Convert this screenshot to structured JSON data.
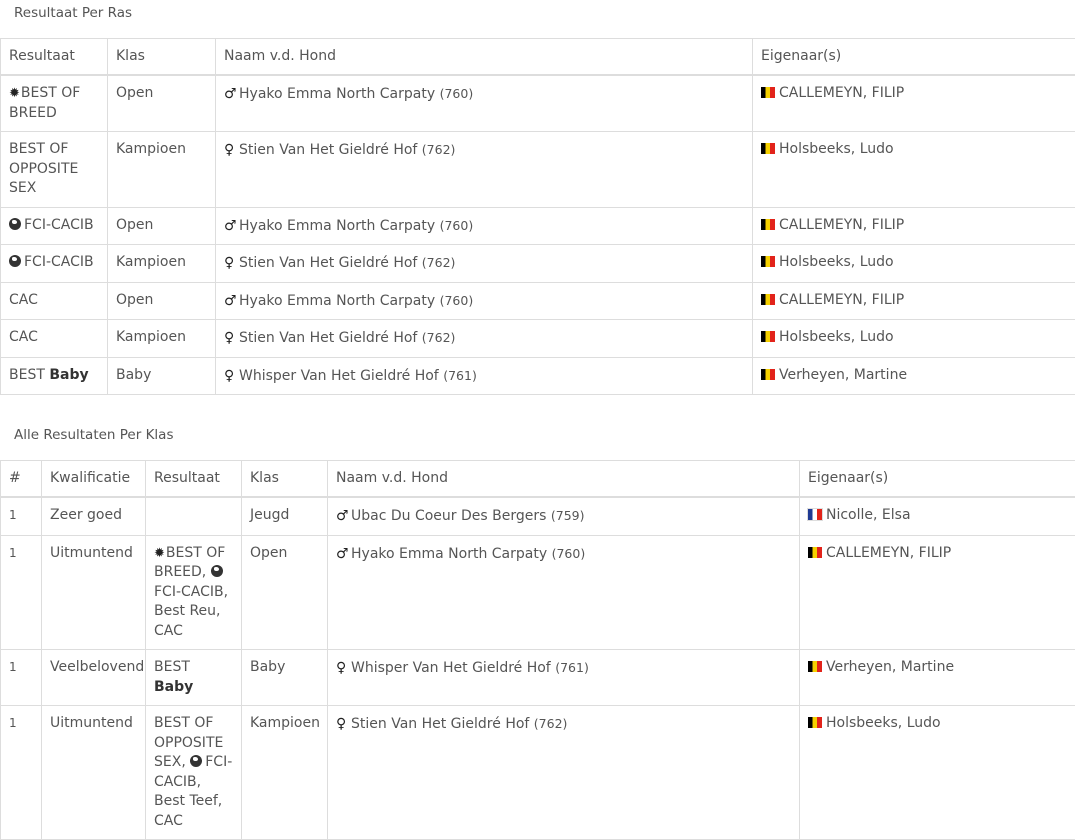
{
  "section1": {
    "title": "Resultaat Per Ras",
    "headers": [
      "Resultaat",
      "Klas",
      "Naam v.d. Hond",
      "Eigenaar(s)"
    ],
    "rows": [
      {
        "icon": "star",
        "result": "BEST OF BREED",
        "klas": "Open",
        "sex": "♂",
        "dog": "Hyako Emma North Carpaty",
        "num": "(760)",
        "flag": "be",
        "owner": "CALLEMEYN, FILIP"
      },
      {
        "icon": "",
        "result": "BEST OF OPPOSITE SEX",
        "klas": "Kampioen",
        "sex": "♀",
        "dog": "Stien Van Het Gieldré Hof",
        "num": "(762)",
        "flag": "be",
        "owner": "Holsbeeks, Ludo"
      },
      {
        "icon": "globe",
        "result": "FCI-CACIB",
        "klas": "Open",
        "sex": "♂",
        "dog": "Hyako Emma North Carpaty",
        "num": "(760)",
        "flag": "be",
        "owner": "CALLEMEYN, FILIP"
      },
      {
        "icon": "globe",
        "result": "FCI-CACIB",
        "klas": "Kampioen",
        "sex": "♀",
        "dog": "Stien Van Het Gieldré Hof",
        "num": "(762)",
        "flag": "be",
        "owner": "Holsbeeks, Ludo"
      },
      {
        "icon": "",
        "result": "CAC",
        "klas": "Open",
        "sex": "♂",
        "dog": "Hyako Emma North Carpaty",
        "num": "(760)",
        "flag": "be",
        "owner": "CALLEMEYN, FILIP"
      },
      {
        "icon": "",
        "result": "CAC",
        "klas": "Kampioen",
        "sex": "♀",
        "dog": "Stien Van Het Gieldré Hof",
        "num": "(762)",
        "flag": "be",
        "owner": "Holsbeeks, Ludo"
      },
      {
        "icon": "",
        "result": "BEST",
        "result_bold": "Baby",
        "klas": "Baby",
        "sex": "♀",
        "dog": "Whisper Van Het Gieldré Hof",
        "num": "(761)",
        "flag": "be",
        "owner": "Verheyen, Martine"
      }
    ]
  },
  "section2": {
    "title": "Alle Resultaten Per Klas",
    "headers": [
      "#",
      "Kwalificatie",
      "Resultaat",
      "Klas",
      "Naam v.d. Hond",
      "Eigenaar(s)"
    ],
    "rows": [
      {
        "rank": "1",
        "kwal": "Zeer goed",
        "klas": "Jeugd",
        "sex": "♂",
        "dog": "Ubac Du Coeur Des Bergers",
        "num": "(759)",
        "flag": "fr",
        "owner": "Nicolle, Elsa",
        "result_parts": []
      },
      {
        "rank": "1",
        "kwal": "Uitmuntend",
        "klas": "Open",
        "sex": "♂",
        "dog": "Hyako Emma North Carpaty",
        "num": "(760)",
        "flag": "be",
        "owner": "CALLEMEYN, FILIP",
        "result_parts": [
          {
            "icon": "star",
            "text": "BEST OF BREED, "
          },
          {
            "icon": "globe",
            "text": "FCI-CACIB, Best Reu, CAC"
          }
        ]
      },
      {
        "rank": "1",
        "kwal": "Veelbelovend",
        "klas": "Baby",
        "sex": "♀",
        "dog": "Whisper Van Het Gieldré Hof",
        "num": "(761)",
        "flag": "be",
        "owner": "Verheyen, Martine",
        "result_parts": [
          {
            "icon": "",
            "text": "BEST ",
            "bold": "Baby"
          }
        ]
      },
      {
        "rank": "1",
        "kwal": "Uitmuntend",
        "klas": "Kampioen",
        "sex": "♀",
        "dog": "Stien Van Het Gieldré Hof",
        "num": "(762)",
        "flag": "be",
        "owner": "Holsbeeks, Ludo",
        "result_parts": [
          {
            "icon": "",
            "text": "BEST OF OPPOSITE SEX, "
          },
          {
            "icon": "globe",
            "text": "FCI-CACIB, Best Teef, CAC"
          }
        ]
      }
    ]
  },
  "icons": {
    "star": "award-star-icon",
    "globe": "globe-icon",
    "male": "male-symbol-icon",
    "female": "female-symbol-icon",
    "flag_be": "belgium-flag-icon",
    "flag_fr": "france-flag-icon"
  },
  "colors": {
    "text": "#555555",
    "border": "#dddddd",
    "bold": "#333333"
  }
}
